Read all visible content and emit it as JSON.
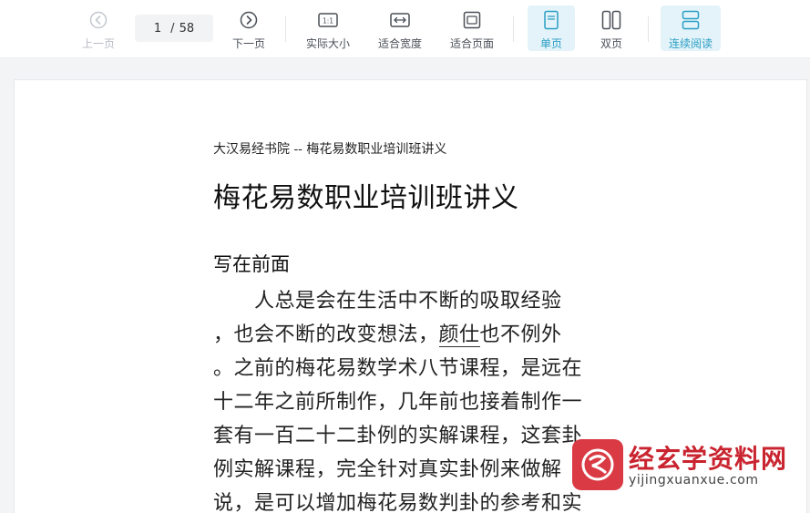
{
  "toolbar": {
    "prev": {
      "label": "上一页",
      "icon": "chevron-left-circle-icon",
      "disabled": true
    },
    "page_current": "1",
    "page_total": "58",
    "page_sep": "/",
    "next": {
      "label": "下一页",
      "icon": "chevron-right-circle-icon"
    },
    "actual_size": {
      "label": "实际大小",
      "icon": "actual-size-icon",
      "icon_text": "1:1"
    },
    "fit_width": {
      "label": "适合宽度",
      "icon": "fit-width-icon"
    },
    "fit_page": {
      "label": "适合页面",
      "icon": "fit-page-icon"
    },
    "single_page": {
      "label": "单页",
      "icon": "single-page-icon",
      "active": true
    },
    "double_page": {
      "label": "双页",
      "icon": "double-page-icon"
    },
    "continuous": {
      "label": "连续阅读",
      "icon": "continuous-read-icon",
      "active": true
    }
  },
  "document": {
    "running_header": "大汉易经书院 -- 梅花易数职业培训班讲义",
    "title": "梅花易数职业培训班讲义",
    "section_heading": "写在前面",
    "lines": [
      {
        "text": "　　人总是会在生活中不断的吸取经验"
      },
      {
        "pre": "，也会不断的改变想法，",
        "underlined": "颜仕",
        "post": "也不例外"
      },
      {
        "text": "。之前的梅花易数学术八节课程，是远在"
      },
      {
        "text": "十二年之前所制作，几年前也接着制作一"
      },
      {
        "text": "套有一百二十二卦例的实解课程，这套卦"
      },
      {
        "text": "例实解课程，完全针对真实卦例来做解"
      },
      {
        "text": "说，是可以增加梅花易数判卦的参考和实"
      }
    ]
  },
  "watermark": {
    "title": "经玄学资料网",
    "url": "yijingxuanxue.com"
  },
  "colors": {
    "accent": "#2a9ec5",
    "active_bg": "#e3f3f9",
    "watermark_red": "#c9242f"
  }
}
